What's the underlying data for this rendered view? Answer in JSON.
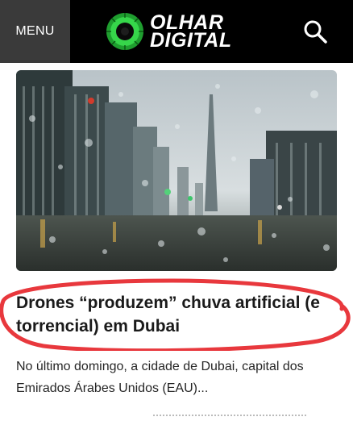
{
  "header": {
    "menu_label": "MENU",
    "logo_line1": "OLHAR",
    "logo_line2": "DIGITAL",
    "search_icon": "search-icon",
    "colors": {
      "background": "#000000",
      "menu_background": "#3a3a3a",
      "logo_green": "#22c23b"
    }
  },
  "article": {
    "title": "Drones “produzem” chuva artificial (e torrencial) em Dubai",
    "excerpt": "No último domingo, a cidade de Dubai, capital dos Emirados Árabes Unidos (EAU)...",
    "highlight_color": "#e8383d"
  }
}
